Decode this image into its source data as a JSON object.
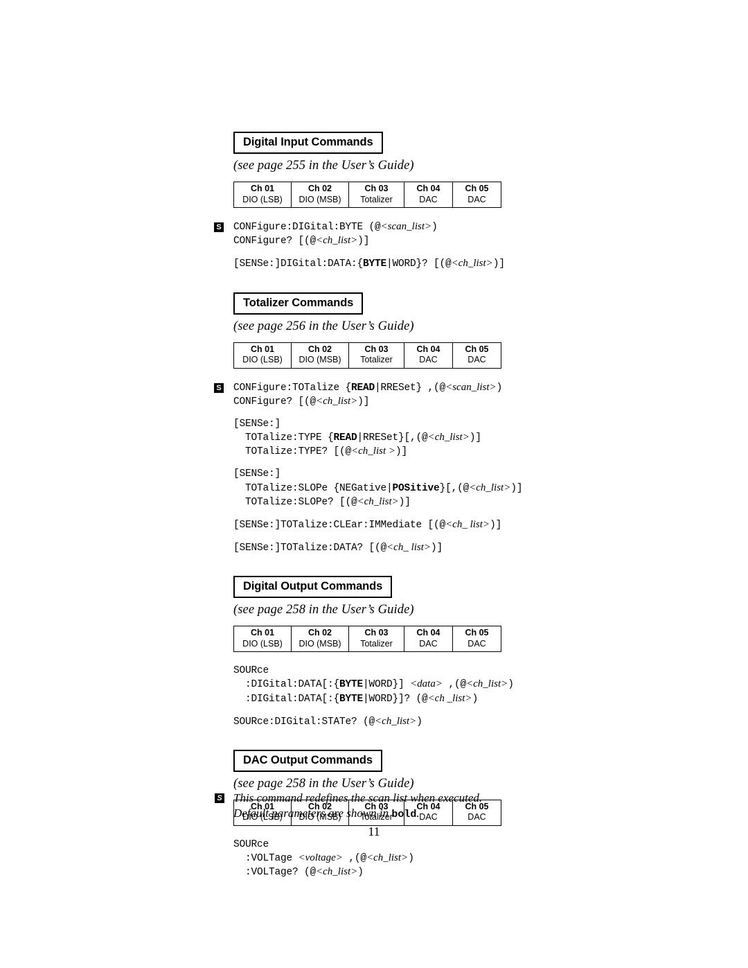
{
  "document": {
    "page_number": "11"
  },
  "channel_table": {
    "columns": [
      {
        "channel": "Ch 01",
        "function": "DIO (LSB)"
      },
      {
        "channel": "Ch 02",
        "function": "DIO (MSB)"
      },
      {
        "channel": "Ch 03",
        "function": "Totalizer"
      },
      {
        "channel": "Ch 04",
        "function": "DAC"
      },
      {
        "channel": "Ch 05",
        "function": "DAC"
      }
    ]
  },
  "sections": [
    {
      "title": "Digital Input Commands",
      "reference": "(see page 255 in the User’s Guide)",
      "scan_marker": "S",
      "blocks": [
        {
          "marker": "S",
          "lines": [
            [
              {
                "t": "CONFigure:DIGital:BYTE (@",
                "s": "mono"
              },
              {
                "t": "<scan_list>",
                "s": "ital"
              },
              {
                "t": ")",
                "s": "mono"
              }
            ],
            [
              {
                "t": "CONFigure? [(@",
                "s": "mono"
              },
              {
                "t": "<ch_list>",
                "s": "ital"
              },
              {
                "t": ")]",
                "s": "mono"
              }
            ]
          ]
        },
        {
          "marker": "",
          "lines": [
            [
              {
                "t": "[SENSe:]DIGital:DATA:{",
                "s": "mono"
              },
              {
                "t": "BYTE",
                "s": "bold"
              },
              {
                "t": "|WORD}? [(@",
                "s": "mono"
              },
              {
                "t": "<ch_list>",
                "s": "ital"
              },
              {
                "t": ")]",
                "s": "mono"
              }
            ]
          ]
        }
      ]
    },
    {
      "title": "Totalizer Commands",
      "reference": "(see page 256 in the User’s Guide)",
      "scan_marker": "S",
      "blocks": [
        {
          "marker": "S",
          "lines": [
            [
              {
                "t": "CONFigure:TOTalize {",
                "s": "mono"
              },
              {
                "t": "READ",
                "s": "bold"
              },
              {
                "t": "|RRESet} ,(@",
                "s": "mono"
              },
              {
                "t": "<scan_list>",
                "s": "ital"
              },
              {
                "t": ")",
                "s": "mono"
              }
            ],
            [
              {
                "t": "CONFigure? [(@",
                "s": "mono"
              },
              {
                "t": "<ch_list>",
                "s": "ital"
              },
              {
                "t": ")]",
                "s": "mono"
              }
            ]
          ]
        },
        {
          "marker": "",
          "lines": [
            [
              {
                "t": "[SENSe:]",
                "s": "mono"
              }
            ],
            [
              {
                "t": "  TOTalize:TYPE {",
                "s": "mono"
              },
              {
                "t": "READ",
                "s": "bold"
              },
              {
                "t": "|RRESet}[,(@",
                "s": "mono"
              },
              {
                "t": "<ch_list>",
                "s": "ital"
              },
              {
                "t": ")]",
                "s": "mono"
              }
            ],
            [
              {
                "t": "  TOTalize:TYPE? [(@",
                "s": "mono"
              },
              {
                "t": "<ch_list >",
                "s": "ital"
              },
              {
                "t": ")]",
                "s": "mono"
              }
            ]
          ]
        },
        {
          "marker": "",
          "lines": [
            [
              {
                "t": "[SENSe:]",
                "s": "mono"
              }
            ],
            [
              {
                "t": "  TOTalize:SLOPe {NEGative|",
                "s": "mono"
              },
              {
                "t": "POSitive",
                "s": "bold"
              },
              {
                "t": "}[,(@",
                "s": "mono"
              },
              {
                "t": "<ch_list>",
                "s": "ital"
              },
              {
                "t": ")]",
                "s": "mono"
              }
            ],
            [
              {
                "t": "  TOTalize:SLOPe? [(@",
                "s": "mono"
              },
              {
                "t": "<ch_list>",
                "s": "ital"
              },
              {
                "t": ")]",
                "s": "mono"
              }
            ]
          ]
        },
        {
          "marker": "",
          "lines": [
            [
              {
                "t": "[SENSe:]TOTalize:CLEar:IMMediate [(@",
                "s": "mono"
              },
              {
                "t": "<ch_ list>",
                "s": "ital"
              },
              {
                "t": ")]",
                "s": "mono"
              }
            ]
          ]
        },
        {
          "marker": "",
          "lines": [
            [
              {
                "t": "[SENSe:]TOTalize:DATA? [(@",
                "s": "mono"
              },
              {
                "t": "<ch_ list>",
                "s": "ital"
              },
              {
                "t": ")]",
                "s": "mono"
              }
            ]
          ]
        }
      ]
    },
    {
      "title": "Digital Output Commands",
      "reference": "(see page 258 in the User’s Guide)",
      "scan_marker": "",
      "blocks": [
        {
          "marker": "",
          "lines": [
            [
              {
                "t": "SOURce",
                "s": "mono"
              }
            ],
            [
              {
                "t": "  :DIGital:DATA[:{",
                "s": "mono"
              },
              {
                "t": "BYTE",
                "s": "bold"
              },
              {
                "t": "|WORD}] ",
                "s": "mono"
              },
              {
                "t": "<data>",
                "s": "ital"
              },
              {
                "t": " ,(@",
                "s": "mono"
              },
              {
                "t": "<ch_list>",
                "s": "ital"
              },
              {
                "t": ")",
                "s": "mono"
              }
            ],
            [
              {
                "t": "  :DIGital:DATA[:{",
                "s": "mono"
              },
              {
                "t": "BYTE",
                "s": "bold"
              },
              {
                "t": "|WORD}]? (@",
                "s": "mono"
              },
              {
                "t": "<ch _list>",
                "s": "ital"
              },
              {
                "t": ")",
                "s": "mono"
              }
            ]
          ]
        },
        {
          "marker": "",
          "lines": [
            [
              {
                "t": "SOURce:DIGital:STATe? (@",
                "s": "mono"
              },
              {
                "t": "<ch_list>",
                "s": "ital"
              },
              {
                "t": ")",
                "s": "mono"
              }
            ]
          ]
        }
      ]
    },
    {
      "title": "DAC Output Commands",
      "reference": "(see page 258 in the User’s Guide)",
      "scan_marker": "",
      "blocks": [
        {
          "marker": "",
          "lines": [
            [
              {
                "t": "SOURce",
                "s": "mono"
              }
            ],
            [
              {
                "t": "  :VOLTage ",
                "s": "mono"
              },
              {
                "t": "<voltage>",
                "s": "ital"
              },
              {
                "t": " ,(@",
                "s": "mono"
              },
              {
                "t": "<ch_list>",
                "s": "ital"
              },
              {
                "t": ")",
                "s": "mono"
              }
            ],
            [
              {
                "t": "  :VOLTage? (@",
                "s": "mono"
              },
              {
                "t": "<ch_list>",
                "s": "ital"
              },
              {
                "t": ")",
                "s": "mono"
              }
            ]
          ]
        }
      ]
    }
  ],
  "footnote": {
    "marker": "S",
    "line1": "This command redefines the scan list when executed.",
    "line2_prefix": "Default parameters are shown in ",
    "line2_bold": "bold",
    "line2_suffix": "."
  }
}
